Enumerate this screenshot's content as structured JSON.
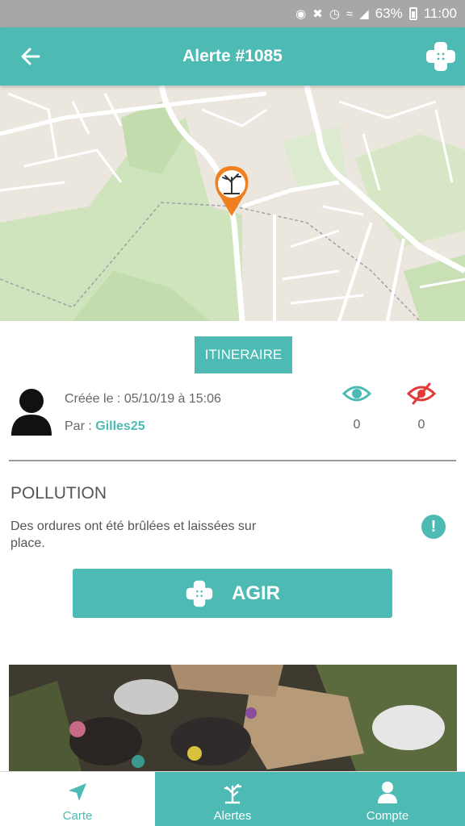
{
  "status_bar": {
    "battery": "63%",
    "time": "11:00"
  },
  "app_bar": {
    "title": "Alerte #1085"
  },
  "actions": {
    "itinerary_label": "ITINERAIRE",
    "act_label": "AGIR"
  },
  "alert": {
    "created_text": "Créée le : 05/10/19 à 15:06",
    "author_prefix": "Par :",
    "author": "Gilles25",
    "seen_count": "0",
    "unseen_count": "0",
    "category": "POLLUTION",
    "description": "Des ordures ont été brûlées et laissées sur place.",
    "alert_icon": "!"
  },
  "nav": {
    "tabs": [
      {
        "label": "Carte",
        "icon": "navigation-arrow-icon",
        "active": true
      },
      {
        "label": "Alertes",
        "icon": "dead-tree-icon",
        "active": false
      },
      {
        "label": "Compte",
        "icon": "user-icon",
        "active": false
      }
    ]
  },
  "colors": {
    "accent": "#4dbab3",
    "marker": "#f07f1f",
    "unseen": "#e53935",
    "status_bar": "#a7a7a7"
  },
  "icons": {
    "back": "arrow-left-icon",
    "plus": "bandage-plus-icon",
    "seen": "eye-icon",
    "unseen": "eye-slash-icon",
    "avatar": "user-avatar-icon",
    "marker": "dead-tree-map-marker-icon"
  }
}
